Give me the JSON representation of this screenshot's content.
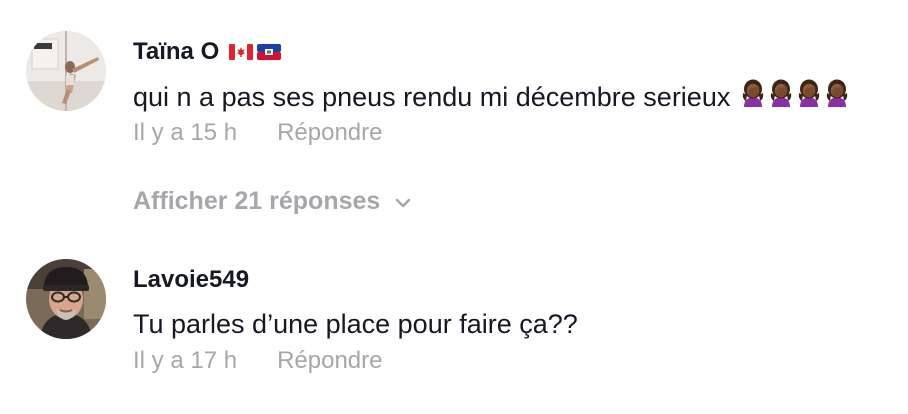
{
  "comments": [
    {
      "username": "Taïna O",
      "flags": [
        "flag-canada-icon",
        "flag-haiti-icon"
      ],
      "text": "qui n a pas ses pneus rendu mi décembre serieux",
      "emoji_count": 4,
      "time": "Il y a 15 h",
      "reply_label": "Répondre"
    },
    {
      "username": "Lavoie549",
      "text": "Tu parles d’une place pour faire ça??",
      "time": "Il y a 17 h",
      "reply_label": "Répondre"
    }
  ],
  "view_replies": {
    "label": "Afficher 21 réponses",
    "icon": "chevron-down-icon"
  },
  "colors": {
    "primary_text": "#161823",
    "secondary_text": "#a7a7ab",
    "background": "#ffffff"
  }
}
